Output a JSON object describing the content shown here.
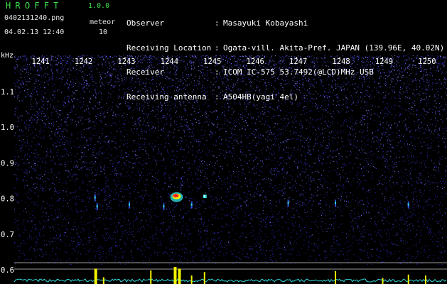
{
  "header": {
    "app_title": "HROFFT",
    "app_version": "1.0.0",
    "filename": "0402131240.png",
    "date": "04.02.13 12:40",
    "meteor_label": "meteor",
    "meteor_count": "10"
  },
  "station_info": [
    {
      "key": "Observer",
      "value": "Masayuki Kobayashi"
    },
    {
      "key": "Receiving Location",
      "value": "Ogata-vill. Akita-Pref. JAPAN (139.96E, 40.02N)"
    },
    {
      "key": "Receiver",
      "value": "ICOM IC-575 53.7492(@LCD)MHz USB"
    },
    {
      "key": "Receiving antenna",
      "value": "A504HB(yagi 4el)"
    }
  ],
  "colors": {
    "background": "#000000",
    "title_green": "#3fe04a",
    "noise_blue": "#2a2ab8",
    "trace_cyan": "#30d8d8",
    "spike_yellow": "#f2f200",
    "echo_red": "#ff2020"
  },
  "chart_data": {
    "type": "heatmap",
    "ylabel": "kHz",
    "x_ticks": [
      "1241",
      "1242",
      "1243",
      "1244",
      "1245",
      "1246",
      "1247",
      "1248",
      "1249",
      "1250"
    ],
    "y_ticks": [
      "1.1",
      "1.0",
      "0.9",
      "0.8",
      "0.7",
      "0.6"
    ],
    "y_values": [
      1.1,
      1.0,
      0.9,
      0.8,
      0.7,
      0.6
    ],
    "ylim": [
      0.58,
      1.18
    ],
    "xlim": [
      1240.6,
      1250.2
    ],
    "grid": false,
    "meteor_echoes": [
      {
        "minute": 1242.3,
        "khz": 0.8,
        "strength": "weak"
      },
      {
        "minute": 1242.35,
        "khz": 0.775,
        "strength": "weak"
      },
      {
        "minute": 1243.1,
        "khz": 0.78,
        "strength": "weak"
      },
      {
        "minute": 1243.9,
        "khz": 0.775,
        "strength": "weak"
      },
      {
        "minute": 1244.15,
        "khz": 0.8,
        "strength": "strong"
      },
      {
        "minute": 1244.55,
        "khz": 0.78,
        "strength": "weak"
      },
      {
        "minute": 1244.85,
        "khz": 0.805,
        "strength": "medium"
      },
      {
        "minute": 1246.8,
        "khz": 0.785,
        "strength": "weak"
      },
      {
        "minute": 1247.9,
        "khz": 0.785,
        "strength": "weak"
      },
      {
        "minute": 1249.6,
        "khz": 0.78,
        "strength": "weak"
      }
    ],
    "spikes": [
      {
        "minute": 1242.3,
        "level": 0.9
      },
      {
        "minute": 1242.5,
        "level": 0.4
      },
      {
        "minute": 1243.6,
        "level": 0.8
      },
      {
        "minute": 1244.15,
        "level": 1.0
      },
      {
        "minute": 1244.25,
        "level": 0.9
      },
      {
        "minute": 1244.55,
        "level": 0.5
      },
      {
        "minute": 1244.85,
        "level": 0.7
      },
      {
        "minute": 1247.9,
        "level": 0.75
      },
      {
        "minute": 1249.0,
        "level": 0.35
      },
      {
        "minute": 1249.6,
        "level": 0.55
      },
      {
        "minute": 1250.0,
        "level": 0.5
      }
    ]
  }
}
